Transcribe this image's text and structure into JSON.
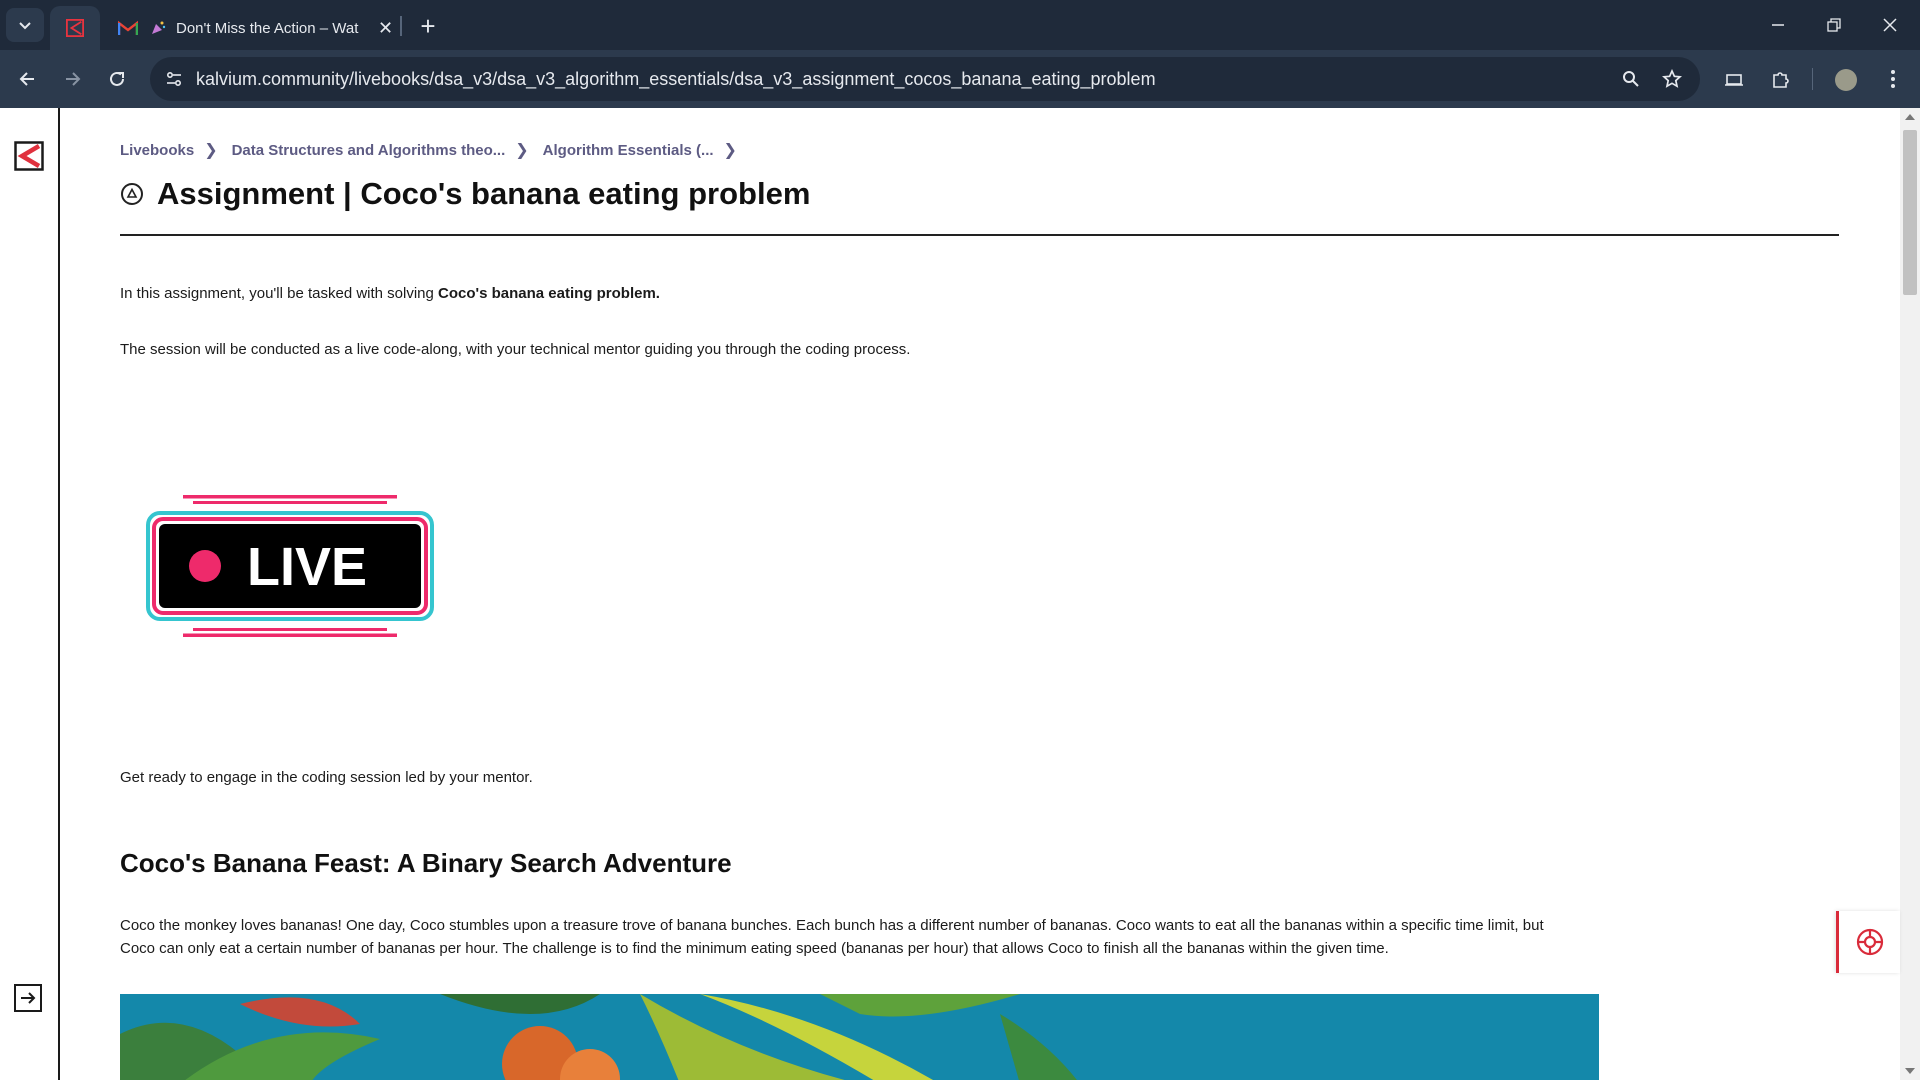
{
  "browser": {
    "tabs": [
      {
        "icon": "kalvium-favicon",
        "title": ""
      },
      {
        "icon": "gmail-favicon",
        "title": "Don't Miss the Action – Wat"
      }
    ],
    "address": "kalvium.community/livebooks/dsa_v3/dsa_v3_algorithm_essentials/dsa_v3_assignment_cocos_banana_eating_problem"
  },
  "breadcrumb": {
    "items": [
      "Livebooks",
      "Data Structures and Algorithms theo...",
      "Algorithm Essentials (..."
    ]
  },
  "page": {
    "title": "Assignment | Coco's banana eating problem",
    "intro_prefix": "In this assignment, you'll be tasked with solving ",
    "intro_bold": "Coco's banana eating problem.",
    "session_text": "The session will be conducted as a live code-along, with your technical mentor guiding you through the coding process.",
    "live_label": "LIVE",
    "ready_text": "Get ready to engage in the coding session led by your mentor.",
    "section_heading": "Coco's Banana Feast: A Binary Search Adventure",
    "section_body": "Coco the monkey loves bananas! One day, Coco stumbles upon a treasure trove of banana bunches. Each bunch has a different number of bananas. Coco wants to eat all the bananas within a specific time limit, but Coco can only eat a certain number of bananas per hour. The challenge is to find the minimum eating speed (bananas per hour) that allows Coco to finish all the bananas within the given time."
  },
  "colors": {
    "breadcrumb": "#5d5b83",
    "accent_red": "#d92b3a",
    "live_pink": "#ee2a6b",
    "live_cyan": "#35c5cf",
    "chrome_dark": "#1f2a3a",
    "chrome_mid": "#2c3a4d"
  }
}
